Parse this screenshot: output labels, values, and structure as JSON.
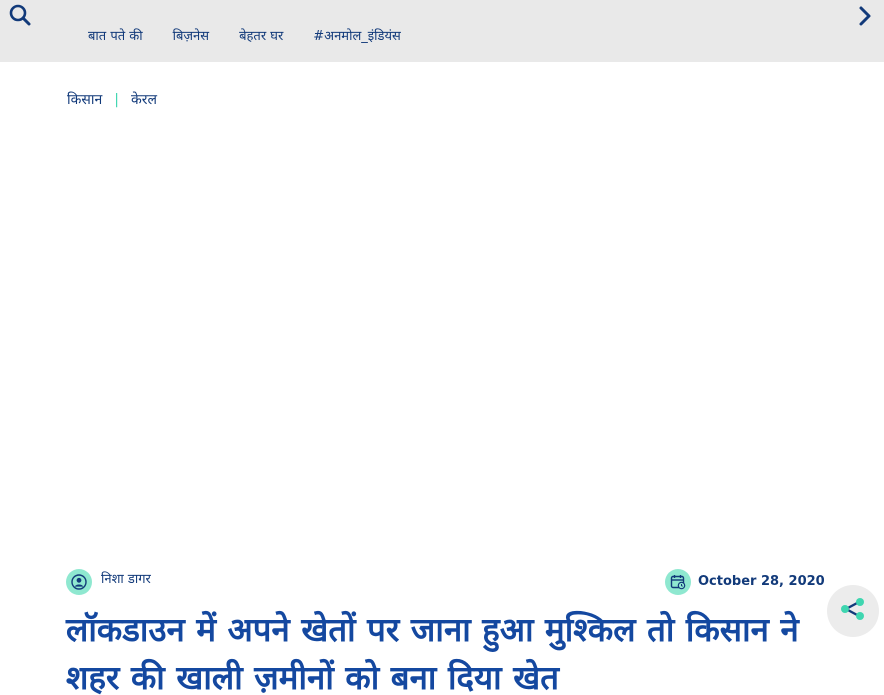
{
  "header": {
    "search_icon": "search-icon",
    "next_icon": "chevron-right-icon",
    "nav": [
      {
        "label": "बात पते की"
      },
      {
        "label": "बिज़नेस"
      },
      {
        "label": "बेहतर घर"
      },
      {
        "label": "#अनमोल_इंडियंस"
      }
    ]
  },
  "breadcrumb": {
    "items": [
      "किसान",
      "केरल"
    ],
    "separator": "|"
  },
  "article": {
    "author": "निशा डागर",
    "date": "October 28, 2020",
    "title": "लॉकडाउन में अपने खेतों पर जाना हुआ मुश्किल तो किसान ने शहर की खाली ज़मीनों को बना दिया खेत"
  },
  "share": {
    "icon": "share-icon"
  },
  "colors": {
    "primary": "#123a7a",
    "headline": "#1448a0",
    "accent": "#3fd6b0",
    "topbar_bg": "#e9e9e9"
  }
}
